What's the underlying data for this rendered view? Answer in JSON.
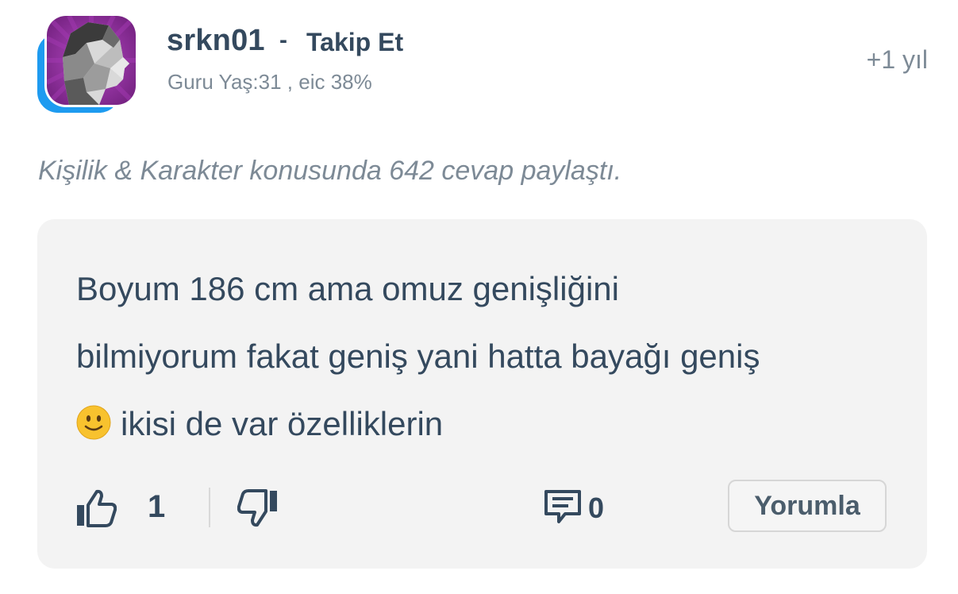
{
  "user": {
    "username": "srkn01",
    "separator": "-",
    "follow_label": "Takip Et",
    "meta": "Guru Yaş:31 , eic 38%",
    "time": "+1 yıl"
  },
  "topic_line": "Kişilik & Karakter konusunda 642 cevap paylaştı.",
  "answer": {
    "line1": "Boyum 186 cm ama omuz genişliğini",
    "line2": "bilmiyorum fakat geniş yani hatta bayağı geniş",
    "line3": "ikisi de var özelliklerin"
  },
  "actions": {
    "like_count": "1",
    "comment_count": "0",
    "reply_label": "Yorumla"
  },
  "colors": {
    "text": "#34495e",
    "muted": "#7d8a96",
    "avatar_accent": "#1e9bf0",
    "avatar_bg": "#8e2a9a",
    "card_bg": "#f3f3f3"
  },
  "icons": [
    "like-icon",
    "dislike-icon",
    "comment-icon",
    "smile-emoji"
  ]
}
